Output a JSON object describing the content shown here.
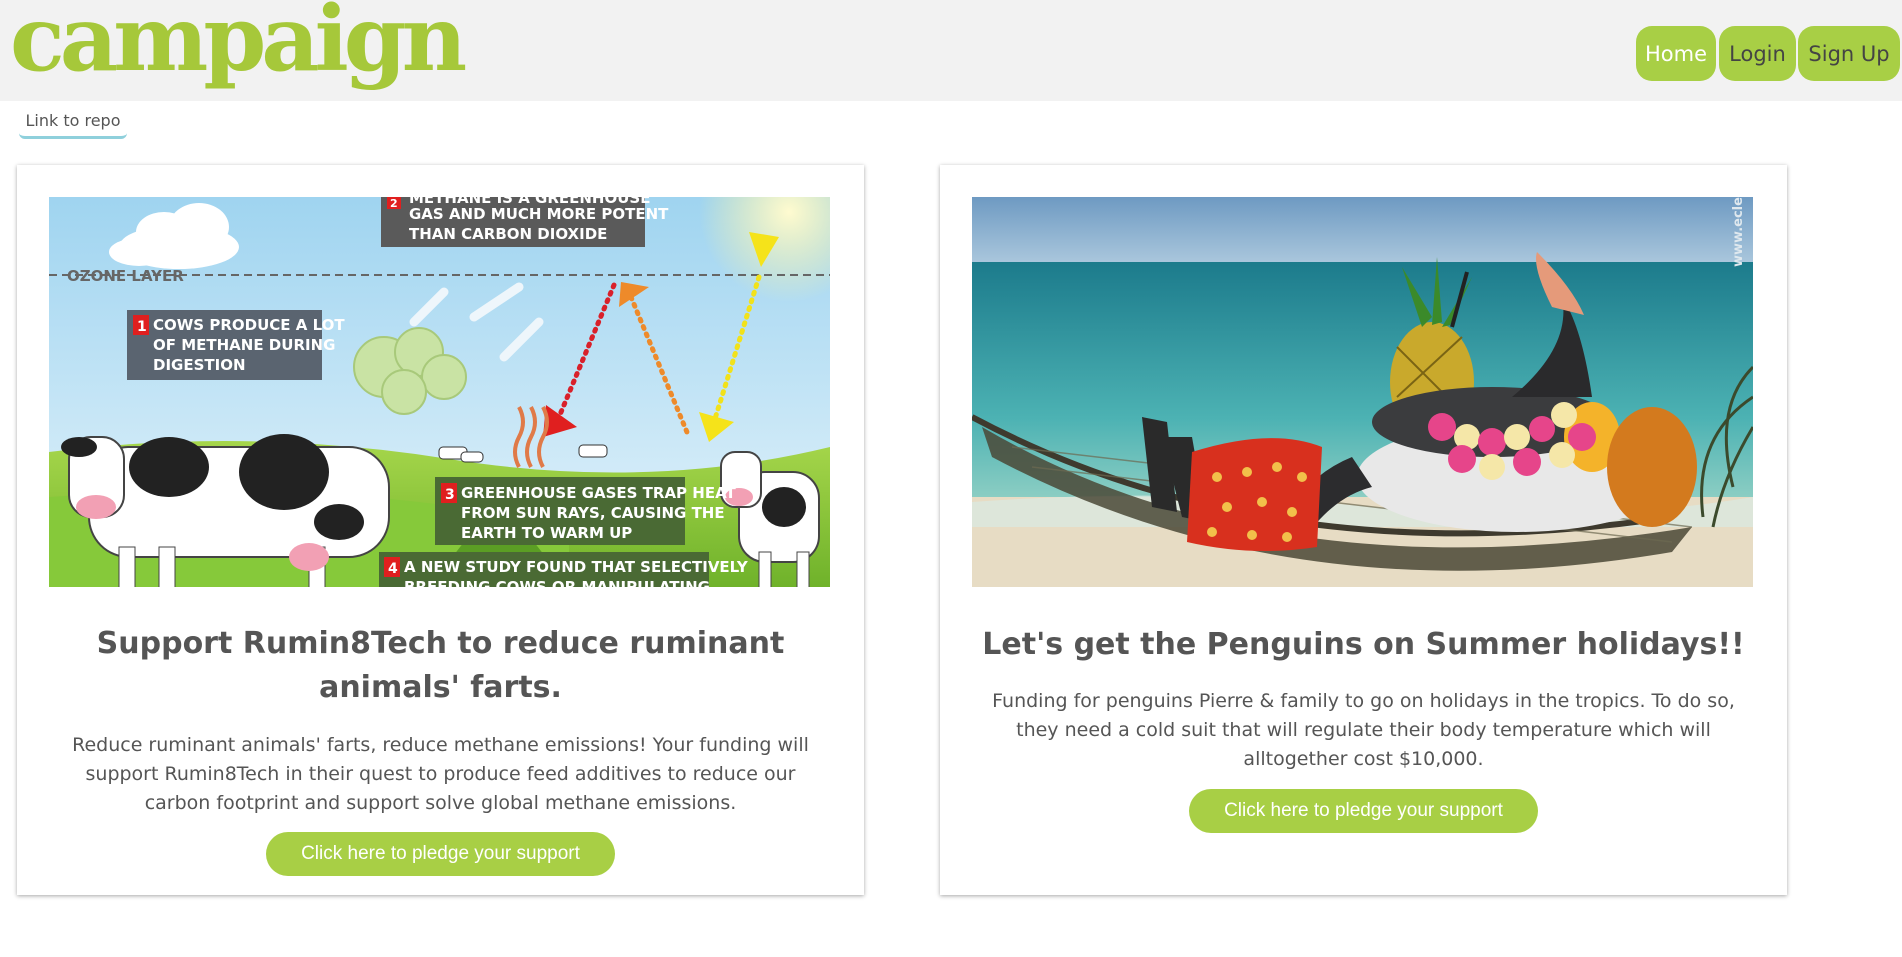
{
  "header": {
    "logo": "campaign",
    "nav": {
      "home": "Home",
      "login": "Login",
      "signup": "Sign Up"
    },
    "colors": {
      "brand": "#a6c83a",
      "button": "#a8cf45",
      "header_bg": "#f2f2f2"
    }
  },
  "repo_link": "Link to repo",
  "campaigns": [
    {
      "title": "Support Rumin8Tech to reduce ruminant animals' farts.",
      "description": "Reduce ruminant animals' farts, reduce methane emissions! Your funding will support Rumin8Tech in their quest to produce feed additives to reduce our carbon footprint and support solve global methane emissions.",
      "pledge_label": "Click here to pledge your support",
      "infographic": {
        "ozone": "OZONE LAYER",
        "step1_num": "1",
        "step1": [
          "COWS PRODUCE A LOT",
          "OF METHANE DURING",
          "DIGESTION"
        ],
        "step2_num": "2",
        "step2": [
          "METHANE IS A GREENHOUSE",
          "GAS AND MUCH MORE POTENT",
          "THAN CARBON DIOXIDE"
        ],
        "step3_num": "3",
        "step3": [
          "GREENHOUSE GASES TRAP HEAT",
          "FROM SUN RAYS, CAUSING THE",
          "EARTH TO WARM UP"
        ],
        "step4_num": "4",
        "step4": [
          "A NEW STUDY FOUND THAT SELECTIVELY",
          "BREEDING COWS OR MANIPULATING"
        ]
      }
    },
    {
      "title": "Let's get the Penguins on Summer holidays!!",
      "description": "Funding for penguins Pierre & family to go on holidays in the tropics. To do so, they need a cold suit that will regulate their body temperature which will alltogether cost $10,000.",
      "pledge_label": "Click here to pledge your support",
      "watermark": "www.ecle"
    }
  ]
}
